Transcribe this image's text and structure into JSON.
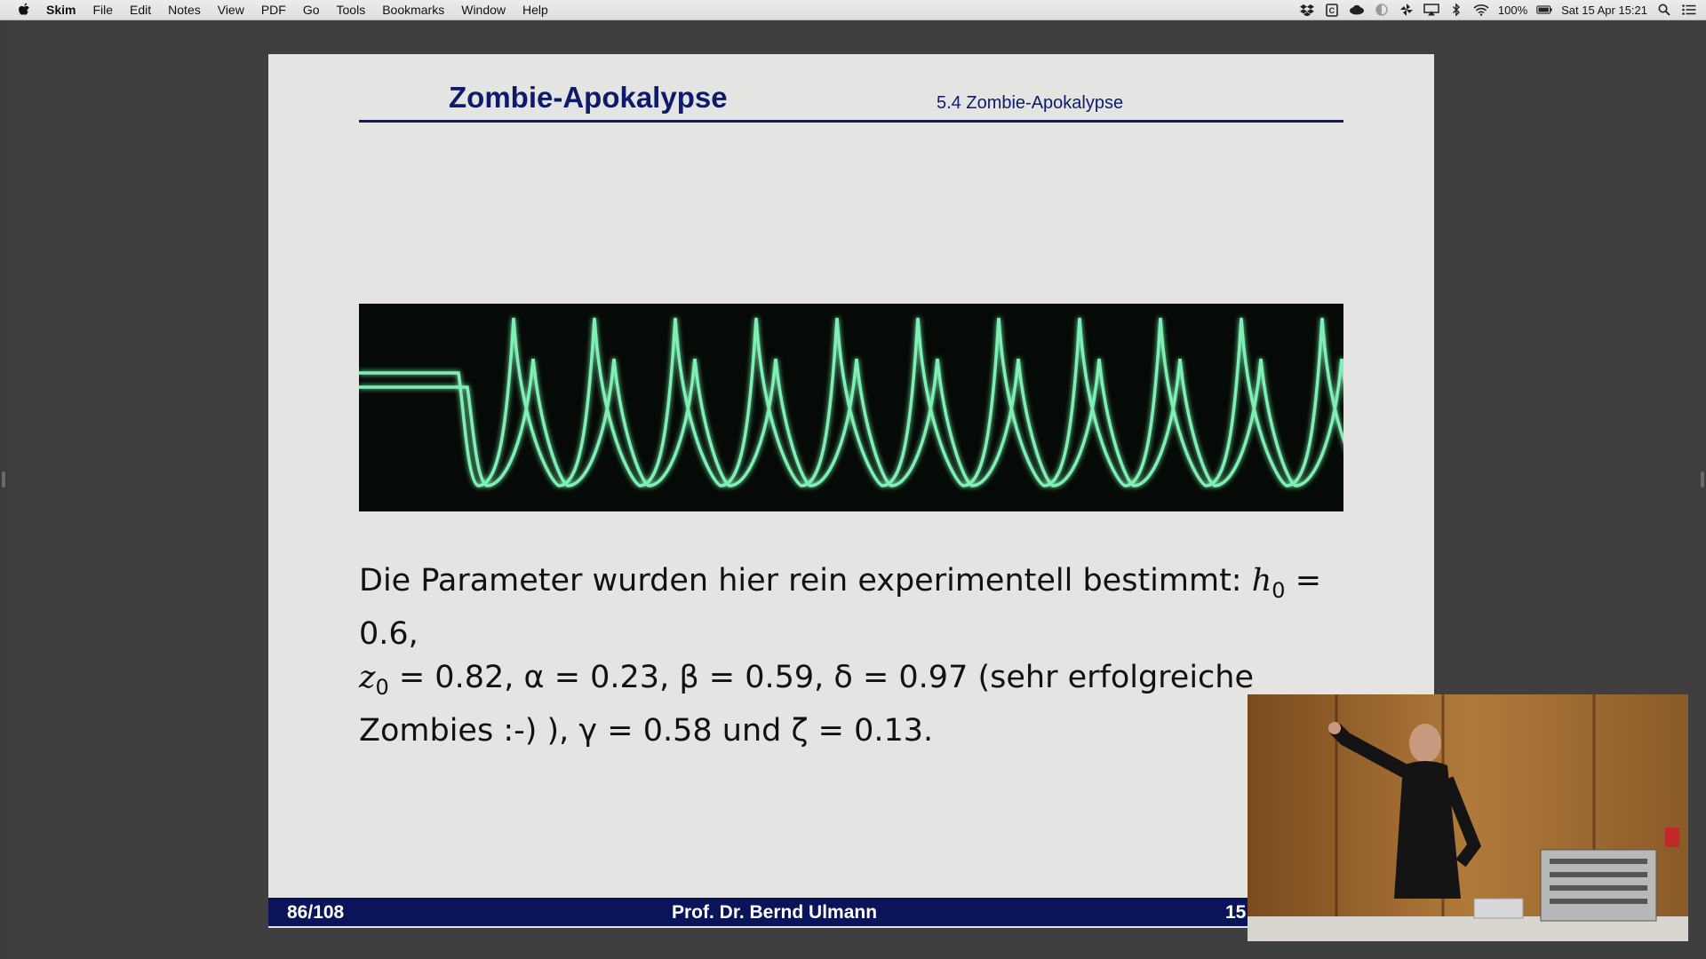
{
  "menubar": {
    "apple_icon": "apple-logo-icon",
    "items": [
      "Skim",
      "File",
      "Edit",
      "Notes",
      "View",
      "PDF",
      "Go",
      "Tools",
      "Bookmarks",
      "Window",
      "Help"
    ],
    "status": {
      "battery": "100%",
      "datetime": "Sat 15 Apr 15:21",
      "icons": [
        "dropbox-icon",
        "clipboard-icon",
        "cloud-icon",
        "moon-icon",
        "pinwheel-icon",
        "airplay-icon",
        "bluetooth-icon",
        "wifi-icon",
        "battery-icon",
        "spotlight-search-icon",
        "notification-list-icon"
      ]
    }
  },
  "slide": {
    "title": "Zombie-Apokalypse",
    "section": "5.4 Zombie-Apokalypse",
    "body": {
      "line1": "Die Parameter wurden hier rein experimentell bestimmt: ",
      "h0": "h",
      "h0_sub": "0",
      "h0_val": " = 0.6,",
      "z0": "z",
      "z0_sub": "0",
      "line2_rest": " = 0.82, α = 0.23, β = 0.59, δ = 0.97 (sehr erfolgreiche",
      "line3": "Zombies :-) ), γ = 0.58 und ζ = 0.13."
    },
    "footer": {
      "page": "86/108",
      "author": "Prof. Dr. Bernd Ulmann",
      "number": "15"
    },
    "scope_color": "#7ef0b4"
  },
  "video": {
    "label": "presenter-video"
  }
}
